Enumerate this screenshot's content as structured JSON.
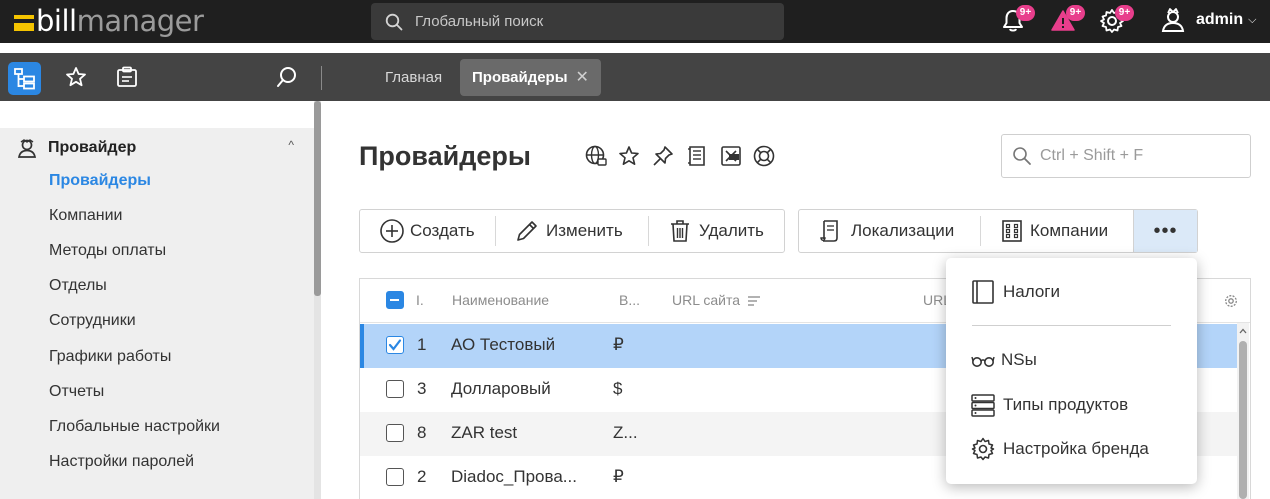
{
  "header": {
    "logo_part1": "bill",
    "logo_part2": "manager",
    "search_placeholder": "Глобальный поиск",
    "notifications": [
      {
        "icon": "bell-icon",
        "badge": "9+"
      },
      {
        "icon": "alert-triangle-icon",
        "badge": "9+"
      },
      {
        "icon": "gear-icon",
        "badge": "9+"
      }
    ],
    "user": {
      "name": "admin",
      "icon": "user-avatar-icon"
    }
  },
  "subbar": {
    "icons": [
      "tree-menu-icon",
      "star-icon",
      "clipboard-icon"
    ],
    "tabs": [
      {
        "label": "Главная",
        "active": false
      },
      {
        "label": "Провайдеры",
        "active": true
      }
    ],
    "close_glyph": "✕"
  },
  "sidebar": {
    "group": {
      "label": "Провайдер",
      "icon": "provider-icon",
      "expanded": true
    },
    "items": [
      {
        "label": "Провайдеры",
        "active": true
      },
      {
        "label": "Компании",
        "active": false
      },
      {
        "label": "Методы оплаты",
        "active": false
      },
      {
        "label": "Отделы",
        "active": false
      },
      {
        "label": "Сотрудники",
        "active": false
      },
      {
        "label": "Графики работы",
        "active": false
      },
      {
        "label": "Отчеты",
        "active": false
      },
      {
        "label": "Глобальные настройки",
        "active": false
      },
      {
        "label": "Настройки паролей",
        "active": false
      }
    ]
  },
  "main": {
    "title": "Провайдеры",
    "title_icons": [
      "globe-icon",
      "star-icon",
      "pin-icon",
      "document-list-icon",
      "export-icon",
      "help-lifebuoy-icon"
    ],
    "quick_search_placeholder": "Ctrl + Shift + F",
    "toolbar": {
      "create": "Создать",
      "edit": "Изменить",
      "delete": "Удалить",
      "localizations": "Локализации",
      "companies": "Компании",
      "more": "•••"
    },
    "table": {
      "columns": [
        "I.",
        "Наименование",
        "В...",
        "URL сайта",
        "URL"
      ],
      "rows": [
        {
          "id": "1",
          "name": "АО Тестовый",
          "currency": "₽",
          "selected": true
        },
        {
          "id": "3",
          "name": "Долларовый",
          "currency": "$",
          "selected": false
        },
        {
          "id": "8",
          "name": "ZAR test",
          "currency": "Z...",
          "selected": false
        },
        {
          "id": "2",
          "name": "Diadoc_Прова...",
          "currency": "₽",
          "selected": false
        }
      ]
    },
    "dropdown": {
      "items": [
        {
          "label": "Налоги",
          "icon": "book-icon"
        },
        {
          "label": "NSы",
          "icon": "glasses-icon"
        },
        {
          "label": "Типы продуктов",
          "icon": "server-list-icon"
        },
        {
          "label": "Настройка бренда",
          "icon": "gear-icon"
        }
      ]
    }
  },
  "colors": {
    "accent": "#2b87e3",
    "badge": "#e83e8c",
    "logo_yellow": "#f5c400",
    "selected_row": "#b3d4f9"
  }
}
